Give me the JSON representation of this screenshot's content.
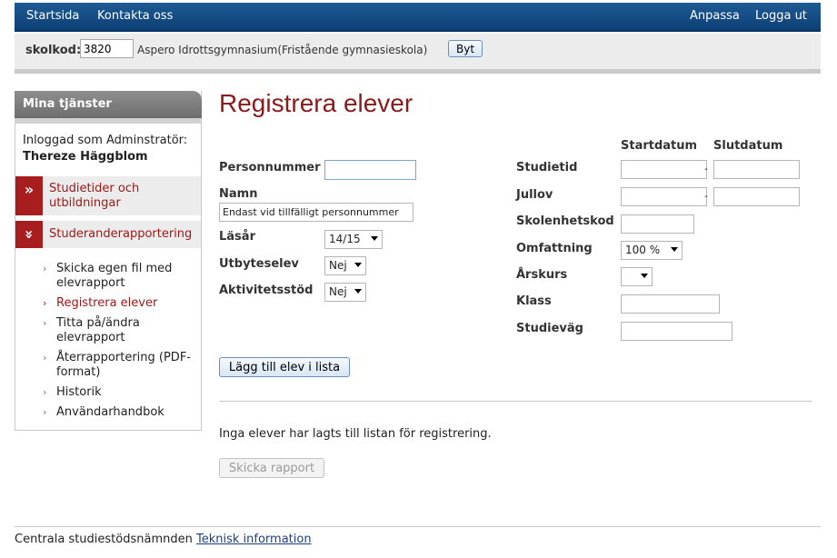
{
  "nav": {
    "home": "Startsida",
    "contact": "Kontakta oss",
    "customize": "Anpassa",
    "logout": "Logga ut"
  },
  "school": {
    "label": "skolkod:",
    "code": "3820",
    "name": "Aspero Idrottsgymnasium(Fristående gymnasieskola)",
    "change_button": "Byt"
  },
  "sidebar": {
    "title": "Mina tjänster",
    "login_line": "Inloggad som Adminstratör:",
    "user": "Thereze Häggblom",
    "categories": [
      {
        "label": "Studietider och utbildningar",
        "icon": "»"
      },
      {
        "label": "Studeranderapportering",
        "icon": "»"
      }
    ],
    "items": [
      {
        "label": "Skicka egen fil med elevrapport"
      },
      {
        "label": "Registrera elever"
      },
      {
        "label": "Titta på/ändra elevrapport"
      },
      {
        "label": "Återrapportering (PDF-format)"
      },
      {
        "label": "Historik"
      },
      {
        "label": "Användarhandbok"
      }
    ]
  },
  "main": {
    "title": "Registrera elever",
    "left_form": {
      "personnummer": {
        "label": "Personnummer",
        "value": ""
      },
      "namn": {
        "label": "Namn",
        "value": "Endast vid tillfälligt personnummer"
      },
      "lasar": {
        "label": "Läsår",
        "value": "14/15"
      },
      "utbyteselev": {
        "label": "Utbyteselev",
        "value": "Nej"
      },
      "aktivitetsstod": {
        "label": "Aktivitetsstöd",
        "value": "Nej"
      }
    },
    "right_form": {
      "col_start": "Startdatum",
      "col_end": "Slutdatum",
      "studietid": {
        "label": "Studietid",
        "dash": "-"
      },
      "jullov": {
        "label": "Jullov",
        "dash": "-"
      },
      "skolenhetskod": {
        "label": "Skolenhetskod"
      },
      "omfattning": {
        "label": "Omfattning",
        "value": "100 %"
      },
      "arskurs": {
        "label": "Årskurs",
        "value": ""
      },
      "klass": {
        "label": "Klass"
      },
      "studievag": {
        "label": "Studieväg"
      }
    },
    "add_button": "Lägg till elev i lista",
    "empty_message": "Inga elever har lagts till listan för registrering.",
    "send_button": "Skicka rapport"
  },
  "footer": {
    "org": "Centrala studiestödsnämnden",
    "link": "Teknisk information"
  }
}
